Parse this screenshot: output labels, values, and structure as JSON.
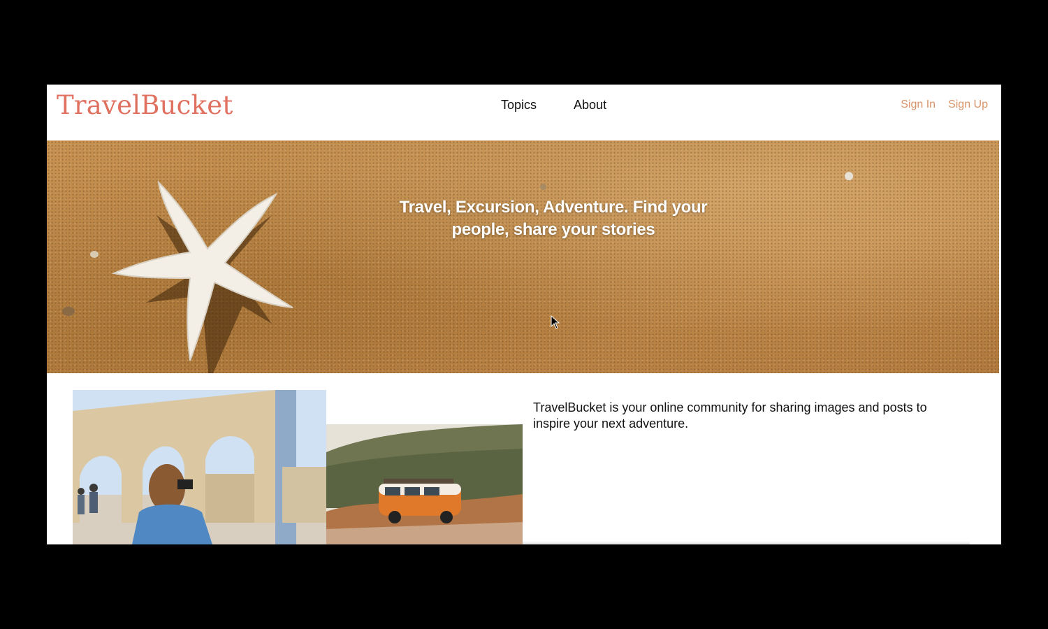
{
  "navbar": {
    "brand": "TravelBucket",
    "links": [
      {
        "label": "Topics"
      },
      {
        "label": "About"
      }
    ],
    "auth": {
      "sign_in": "Sign In",
      "sign_up": "Sign Up"
    }
  },
  "hero": {
    "headline": "Travel, Excursion, Adventure. Find your people, share your stories"
  },
  "intro": {
    "text": "TravelBucket is your online community for sharing images and posts to inspire your next adventure."
  },
  "colors": {
    "brand": "#e0705f",
    "auth_link": "#d99468",
    "sand": "#c08a4a",
    "background": "#ffffff"
  },
  "icons": {
    "cursor": "arrow-cursor-icon"
  }
}
